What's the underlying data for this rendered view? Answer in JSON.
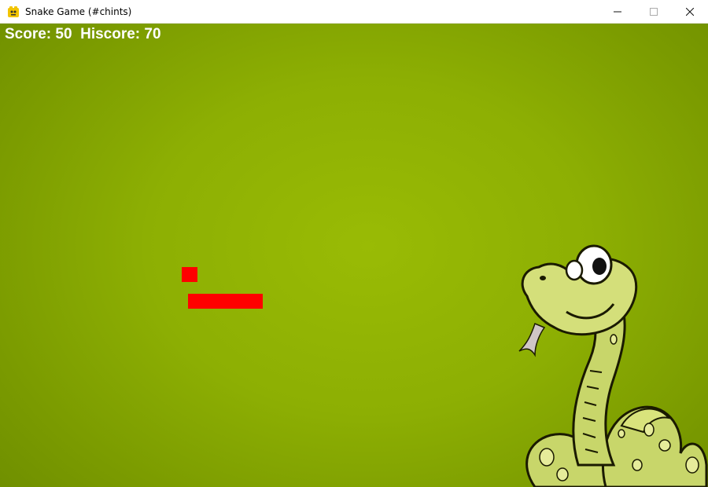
{
  "window": {
    "title": "Snake Game (#chints)",
    "icon": "pygame-snake-icon",
    "controls": [
      "minimize",
      "maximize",
      "close"
    ]
  },
  "game": {
    "score_text": "Score: 50  Hiscore: 70",
    "score": 50,
    "hiscore": 70,
    "background_color": "#8daf03",
    "snake_color": "#ff0000",
    "food_color": "#ff0000",
    "mascot": "cartoon-snake-illustration"
  }
}
